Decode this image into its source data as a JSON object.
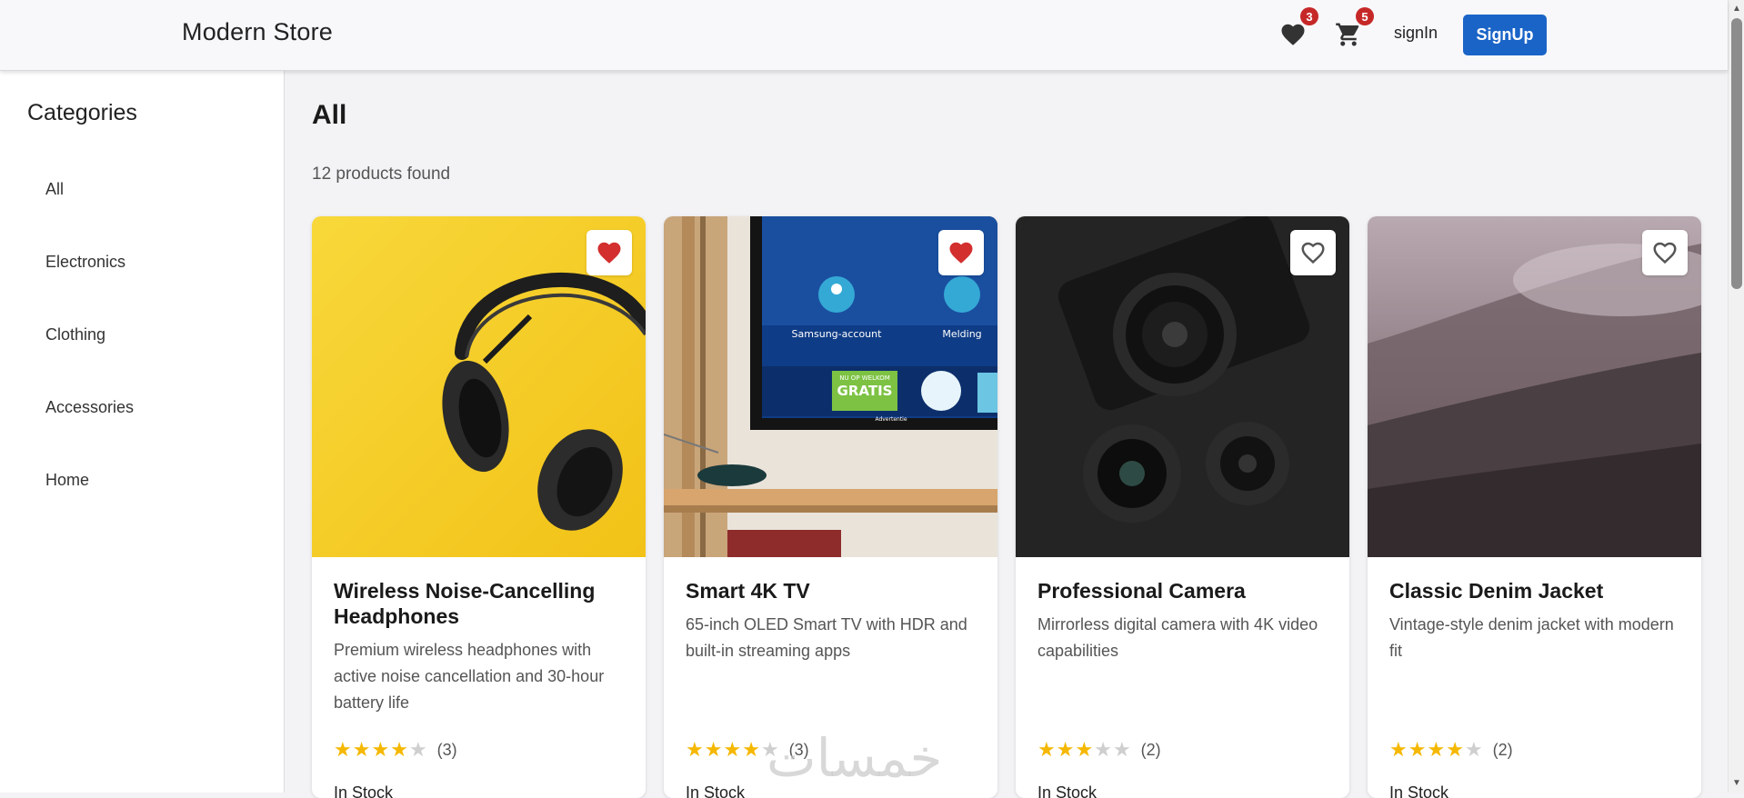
{
  "header": {
    "brand": "Modern Store",
    "wishlist_count": "3",
    "cart_count": "5",
    "signin_label": "signIn",
    "signup_label": "SignUp",
    "accent_color": "#1a64c7",
    "badge_color": "#c62828"
  },
  "sidebar": {
    "title": "Categories",
    "items": [
      {
        "label": "All"
      },
      {
        "label": "Electronics"
      },
      {
        "label": "Clothing"
      },
      {
        "label": "Accessories"
      },
      {
        "label": "Home"
      }
    ]
  },
  "main": {
    "title": "All",
    "count_text": "12 products found"
  },
  "products": [
    {
      "title": "Wireless Noise-Cancelling Headphones",
      "description": "Premium wireless headphones with active noise cancellation and 30-hour battery life",
      "rating": 4,
      "reviews": "(3)",
      "stock": "In Stock",
      "favorited": true,
      "image": "headphones-photo"
    },
    {
      "title": "Smart 4K TV",
      "description": "65-inch OLED Smart TV with HDR and built-in streaming apps",
      "rating": 4,
      "reviews": "(3)",
      "stock": "In Stock",
      "favorited": true,
      "image": "tv-photo",
      "tv_screen": {
        "left_label": "Samsung-account",
        "right_label": "Melding",
        "banner_top": "NU OP WELKOM",
        "banner_main": "GRATIS",
        "banner_sub": "Advertentie"
      }
    },
    {
      "title": "Professional Camera",
      "description": "Mirrorless digital camera with 4K video capabilities",
      "rating": 3,
      "reviews": "(2)",
      "stock": "In Stock",
      "favorited": false,
      "image": "camera-photo"
    },
    {
      "title": "Classic Denim Jacket",
      "description": "Vintage-style denim jacket with modern fit",
      "rating": 4,
      "reviews": "(2)",
      "stock": "In Stock",
      "favorited": false,
      "image": "misty-mountain-photo"
    }
  ],
  "watermark": "خمسات"
}
